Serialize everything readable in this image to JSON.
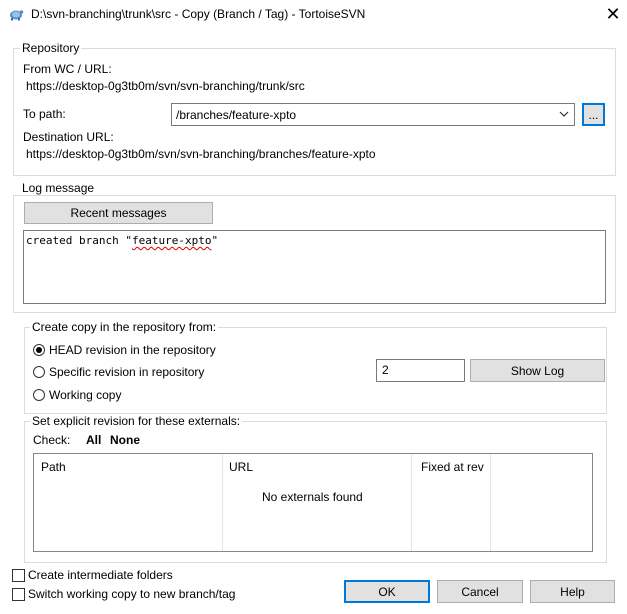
{
  "window": {
    "title": "D:\\svn-branching\\trunk\\src - Copy (Branch / Tag) - TortoiseSVN",
    "close_glyph": "✕"
  },
  "repository": {
    "group_label": "Repository",
    "from_label": "From WC / URL:",
    "from_value": "https://desktop-0g3tb0m/svn/svn-branching/trunk/src",
    "to_label": "To path:",
    "to_value": "/branches/feature-xpto",
    "browse_label": "...",
    "dest_label": "Destination URL:",
    "dest_value": "https://desktop-0g3tb0m/svn/svn-branching/branches/feature-xpto"
  },
  "log": {
    "group_label": "Log message",
    "recent_label": "Recent messages",
    "message_prefix": "created branch \"",
    "message_word": "feature-xpto",
    "message_suffix": "\""
  },
  "copy_from": {
    "group_label": "Create copy in the repository from:",
    "options": [
      {
        "label": "HEAD revision in the repository",
        "checked": true
      },
      {
        "label": "Specific revision in repository",
        "checked": false
      },
      {
        "label": "Working copy",
        "checked": false
      }
    ],
    "revision_value": "2",
    "show_log_label": "Show Log"
  },
  "externals": {
    "group_label": "Set explicit revision for these externals:",
    "check_label": "Check:",
    "all_label": "All",
    "none_label": "None",
    "columns": [
      "Path",
      "URL",
      "Fixed at rev"
    ],
    "empty_text": "No externals found"
  },
  "footer": {
    "intermediate_label": "Create intermediate folders",
    "intermediate_checked": false,
    "switch_label": "Switch working copy to new branch/tag",
    "switch_checked": false,
    "ok_label": "OK",
    "cancel_label": "Cancel",
    "help_label": "Help"
  }
}
